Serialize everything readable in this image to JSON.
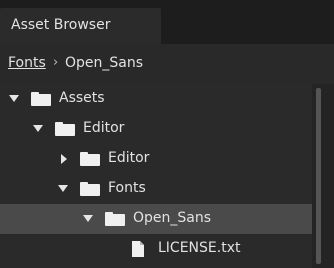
{
  "window": {
    "tab_label": "Asset Browser"
  },
  "breadcrumb": {
    "parent": "Fonts",
    "separator": "›",
    "current": "Open_Sans"
  },
  "tree": {
    "items": [
      {
        "label": "Assets",
        "type": "folder",
        "expanded": true,
        "icon": "folder-icon"
      },
      {
        "label": "Editor",
        "type": "folder",
        "expanded": true,
        "icon": "folder-icon"
      },
      {
        "label": "Editor",
        "type": "folder",
        "expanded": false,
        "icon": "folder-icon"
      },
      {
        "label": "Fonts",
        "type": "folder",
        "expanded": true,
        "icon": "folder-icon"
      },
      {
        "label": "Open_Sans",
        "type": "folder",
        "expanded": true,
        "selected": true,
        "icon": "folder-icon"
      },
      {
        "label": "LICENSE.txt",
        "type": "file",
        "icon": "file-icon"
      }
    ]
  },
  "colors": {
    "background": "#292929",
    "selected_row": "#4a4a4a",
    "text": "#e2e2e2"
  }
}
